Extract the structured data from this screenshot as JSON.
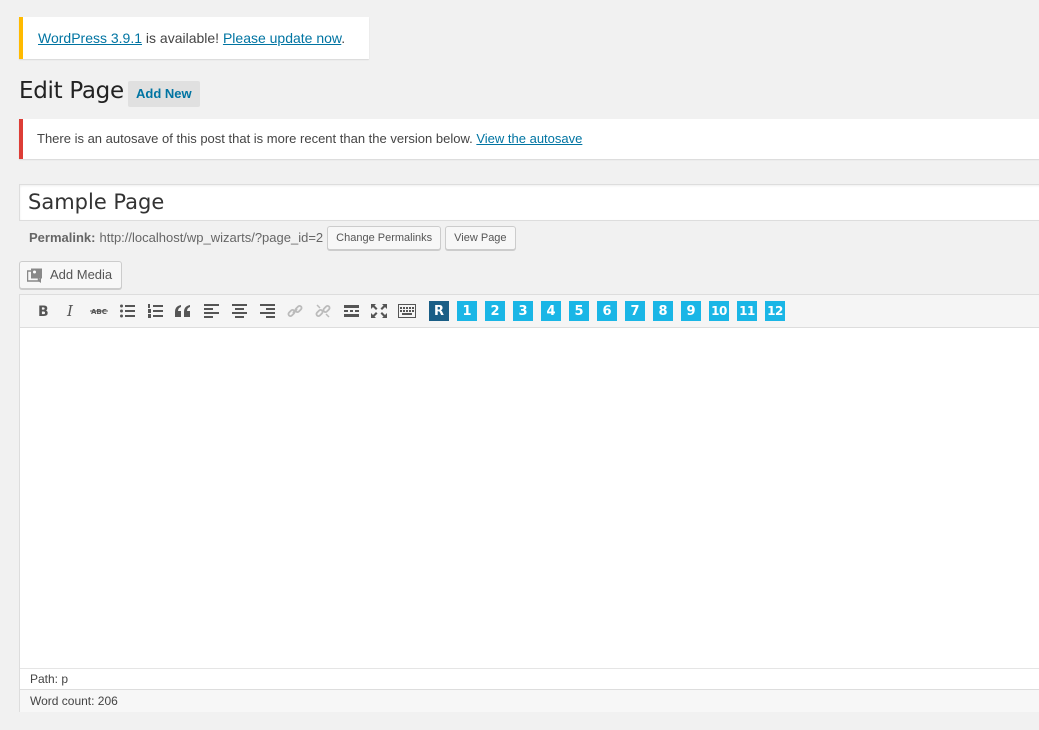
{
  "update_nag": {
    "version_link": "WordPress 3.9.1",
    "middle_text": " is available! ",
    "update_link": "Please update now",
    "end_text": "."
  },
  "header": {
    "title": "Edit Page",
    "add_new_label": "Add New"
  },
  "autosave_notice": {
    "text": "There is an autosave of this post that is more recent than the version below. ",
    "link": "View the autosave"
  },
  "post": {
    "title": "Sample Page"
  },
  "permalink": {
    "label": "Permalink:",
    "url": "http://localhost/wp_wizarts/?page_id=2",
    "change_button": "Change Permalinks",
    "view_button": "View Page"
  },
  "media": {
    "add_media_label": "Add Media"
  },
  "toolbar": {
    "buttons": [
      "bold",
      "italic",
      "strikethrough",
      "bullet-list",
      "numbered-list",
      "blockquote",
      "align-left",
      "align-center",
      "align-right",
      "insert-link",
      "remove-link",
      "read-more",
      "fullscreen",
      "toolbar-toggle"
    ],
    "shortcode_buttons": [
      "R",
      "1",
      "2",
      "3",
      "4",
      "5",
      "6",
      "7",
      "8",
      "9",
      "10",
      "11",
      "12"
    ]
  },
  "status": {
    "path_label": "Path: p",
    "word_count_label": "Word count: 206"
  }
}
